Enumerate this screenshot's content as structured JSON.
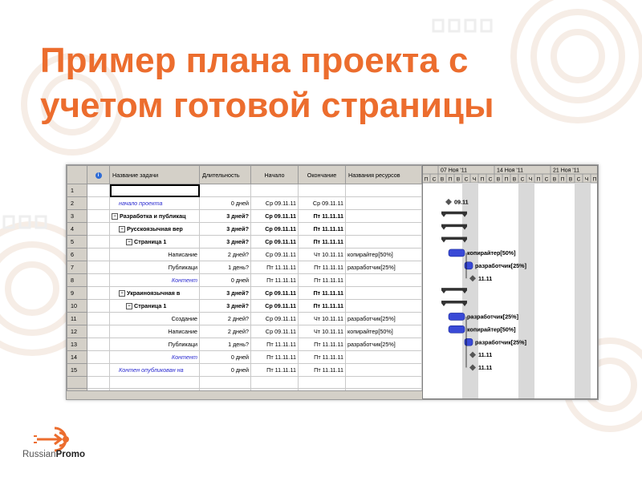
{
  "slide": {
    "title_line1": "Пример плана проекта с",
    "title_line2": "учетом готовой страницы"
  },
  "brand": {
    "name_part1": "Russian",
    "name_part2": "Promo",
    "color": "#ec6d2e"
  },
  "project": {
    "columns": {
      "id": "",
      "info": "i",
      "name": "Название задачи",
      "duration": "Длительность",
      "start": "Начало",
      "finish": "Окончание",
      "resources": "Названия ресурсов"
    },
    "rows": [
      {
        "id": "1",
        "name": "",
        "duration": "",
        "start": "",
        "finish": "",
        "resources": "",
        "style": "normal",
        "indent": 0
      },
      {
        "id": "2",
        "name": "начало проекта",
        "duration": "0 дней",
        "start": "Ср 09.11.11",
        "finish": "Ср 09.11.11",
        "resources": "",
        "style": "blue",
        "indent": 1
      },
      {
        "id": "3",
        "name": "Разработка и публикац",
        "duration": "3 дней?",
        "start": "Ср 09.11.11",
        "finish": "Пт 11.11.11",
        "resources": "",
        "style": "bold",
        "indent": 0,
        "toggle": "−"
      },
      {
        "id": "4",
        "name": "Русскоязычная вер",
        "duration": "3 дней?",
        "start": "Ср 09.11.11",
        "finish": "Пт 11.11.11",
        "resources": "",
        "style": "bold",
        "indent": 1,
        "toggle": "−"
      },
      {
        "id": "5",
        "name": "Страница 1",
        "duration": "3 дней?",
        "start": "Ср 09.11.11",
        "finish": "Пт 11.11.11",
        "resources": "",
        "style": "bold",
        "indent": 2,
        "toggle": "−"
      },
      {
        "id": "6",
        "name": "Написание",
        "duration": "2 дней?",
        "start": "Ср 09.11.11",
        "finish": "Чт 10.11.11",
        "resources": "копирайтер[50%]",
        "style": "normal",
        "indent": 3
      },
      {
        "id": "7",
        "name": "Публикаци",
        "duration": "1 день?",
        "start": "Пт 11.11.11",
        "finish": "Пт 11.11.11",
        "resources": "разработчик[25%]",
        "style": "normal",
        "indent": 3
      },
      {
        "id": "8",
        "name": "Контент",
        "duration": "0 дней",
        "start": "Пт 11.11.11",
        "finish": "Пт 11.11.11",
        "resources": "",
        "style": "blue",
        "indent": 3
      },
      {
        "id": "9",
        "name": "Украиноязычная в",
        "duration": "3 дней?",
        "start": "Ср 09.11.11",
        "finish": "Пт 11.11.11",
        "resources": "",
        "style": "bold",
        "indent": 1,
        "toggle": "−"
      },
      {
        "id": "10",
        "name": "Страница 1",
        "duration": "3 дней?",
        "start": "Ср 09.11.11",
        "finish": "Пт 11.11.11",
        "resources": "",
        "style": "bold",
        "indent": 2,
        "toggle": "−"
      },
      {
        "id": "11",
        "name": "Создание",
        "duration": "2 дней?",
        "start": "Ср 09.11.11",
        "finish": "Чт 10.11.11",
        "resources": "разработчик[25%]",
        "style": "normal",
        "indent": 3
      },
      {
        "id": "12",
        "name": "Написание",
        "duration": "2 дней?",
        "start": "Ср 09.11.11",
        "finish": "Чт 10.11.11",
        "resources": "копирайтер[50%]",
        "style": "normal",
        "indent": 3
      },
      {
        "id": "13",
        "name": "Публикаци",
        "duration": "1 день?",
        "start": "Пт 11.11.11",
        "finish": "Пт 11.11.11",
        "resources": "разработчик[25%]",
        "style": "normal",
        "indent": 3
      },
      {
        "id": "14",
        "name": "Контент",
        "duration": "0 дней",
        "start": "Пт 11.11.11",
        "finish": "Пт 11.11.11",
        "resources": "",
        "style": "blue",
        "indent": 3
      },
      {
        "id": "15",
        "name": "Контен опубликован на",
        "duration": "0 дней",
        "start": "Пт 11.11.11",
        "finish": "Пт 11.11.11",
        "resources": "",
        "style": "blue",
        "indent": 1
      }
    ],
    "timeline": {
      "weeks": [
        "07 Ноя '11",
        "14 Ноя '11",
        "21 Ноя '11"
      ],
      "days": [
        "П",
        "С",
        "В",
        "П",
        "В",
        "С",
        "Ч",
        "П",
        "С",
        "В",
        "П",
        "В",
        "С",
        "Ч",
        "П",
        "С",
        "В",
        "П",
        "В",
        "С",
        "Ч",
        "П"
      ]
    },
    "gantt": [
      {
        "row": 2,
        "type": "milestone",
        "start": 3,
        "label": "09.11"
      },
      {
        "row": 3,
        "type": "summary",
        "start": 2,
        "end": 5
      },
      {
        "row": 4,
        "type": "summary",
        "start": 2,
        "end": 5
      },
      {
        "row": 5,
        "type": "summary",
        "start": 2,
        "end": 5
      },
      {
        "row": 6,
        "type": "task",
        "start": 3,
        "end": 5,
        "label": "копирайтер[50%]"
      },
      {
        "row": 7,
        "type": "task",
        "start": 5,
        "end": 6,
        "label": "разработчик[25%]"
      },
      {
        "row": 8,
        "type": "milestone",
        "start": 6,
        "label": "11.11"
      },
      {
        "row": 9,
        "type": "summary",
        "start": 2,
        "end": 5
      },
      {
        "row": 10,
        "type": "summary",
        "start": 2,
        "end": 5
      },
      {
        "row": 11,
        "type": "task",
        "start": 3,
        "end": 5,
        "label": "разработчик[25%]"
      },
      {
        "row": 12,
        "type": "task",
        "start": 3,
        "end": 5,
        "label": "копирайтер[50%]"
      },
      {
        "row": 13,
        "type": "task",
        "start": 5,
        "end": 6,
        "label": "разработчик[25%]"
      },
      {
        "row": 14,
        "type": "milestone",
        "start": 6,
        "label": "11.11"
      },
      {
        "row": 15,
        "type": "milestone",
        "start": 6,
        "label": "11.11"
      }
    ],
    "colors": {
      "task": "#3949d6",
      "summary": "#333333",
      "grey_band": "#d9d9d9",
      "header": "#d4d0c8"
    }
  }
}
